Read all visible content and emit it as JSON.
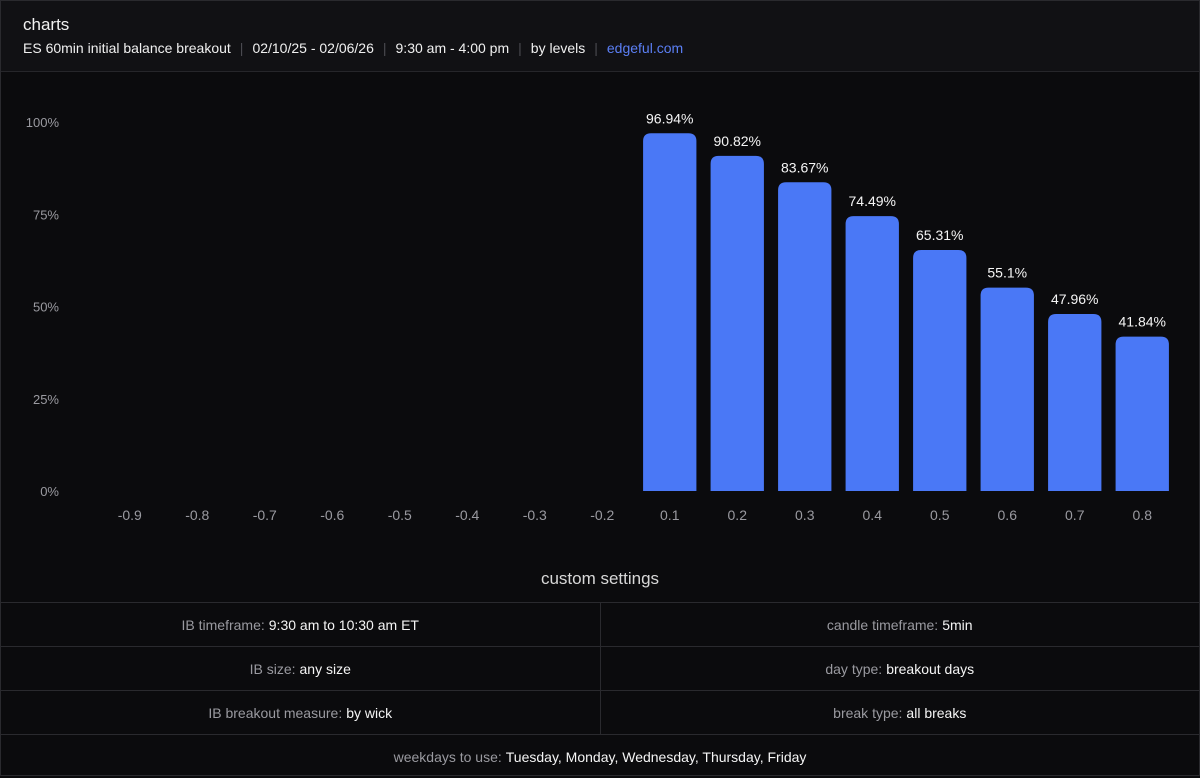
{
  "header": {
    "title": "charts",
    "segments": [
      "ES 60min initial balance breakout",
      "02/10/25 - 02/06/26",
      "9:30 am - 4:00 pm",
      "by levels"
    ],
    "link": "edgeful.com"
  },
  "chart_data": {
    "type": "bar",
    "categories": [
      "-0.9",
      "-0.8",
      "-0.7",
      "-0.6",
      "-0.5",
      "-0.4",
      "-0.3",
      "-0.2",
      "0.1",
      "0.2",
      "0.3",
      "0.4",
      "0.5",
      "0.6",
      "0.7",
      "0.8"
    ],
    "values": [
      0,
      0,
      0,
      0,
      0,
      0,
      0,
      0,
      96.94,
      90.82,
      83.67,
      74.49,
      65.31,
      55.1,
      47.96,
      41.84
    ],
    "data_labels": [
      "",
      "",
      "",
      "",
      "",
      "",
      "",
      "",
      "96.94%",
      "90.82%",
      "83.67%",
      "74.49%",
      "65.31%",
      "55.1%",
      "47.96%",
      "41.84%"
    ],
    "y_ticks": [
      "0%",
      "25%",
      "50%",
      "75%",
      "100%"
    ],
    "ylim": [
      0,
      100
    ],
    "grid": false,
    "bar_color": "#4a78f6"
  },
  "settings": {
    "title": "custom settings",
    "ib_timeframe": {
      "label": "IB timeframe:",
      "value": "9:30 am to 10:30 am ET"
    },
    "candle_timeframe": {
      "label": "candle timeframe:",
      "value": "5min"
    },
    "ib_size": {
      "label": "IB size:",
      "value": "any size"
    },
    "day_type": {
      "label": "day type:",
      "value": "breakout days"
    },
    "ib_breakout_measure": {
      "label": "IB breakout measure:",
      "value": "by wick"
    },
    "break_type": {
      "label": "break type:",
      "value": "all breaks"
    },
    "weekdays": {
      "label": "weekdays to use:",
      "value": "Tuesday, Monday, Wednesday, Thursday, Friday"
    }
  },
  "colors": {
    "accent": "#4a78f6",
    "link": "#5b7ff5",
    "background": "#0b0b0d"
  }
}
